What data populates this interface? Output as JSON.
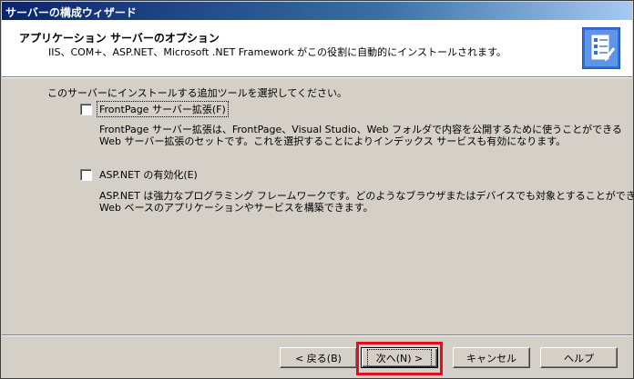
{
  "window": {
    "title": "サーバーの構成ウィザード"
  },
  "header": {
    "title": "アプリケーション サーバーのオプション",
    "subtitle": "IIS、COM+、ASP.NET、Microsoft .NET Framework がこの役割に自動的にインストールされます。",
    "icon": "wizard-checklist-icon"
  },
  "intro": "このサーバーにインストールする追加ツールを選択してください。",
  "options": [
    {
      "label": "FrontPage サーバー拡張(F)",
      "checked": false,
      "desc_line1": "FrontPage サーバー拡張は、FrontPage、Visual Studio、Web フォルダで内容を公開するために使うことができる",
      "desc_line2": "Web サーバー拡張のセットです。これを選択することによりインデックス サービスも有効になります。"
    },
    {
      "label": "ASP.NET の有効化(E)",
      "checked": false,
      "desc_line1": "ASP.NET は強力なプログラミング フレームワークです。どのようなブラウザまたはデバイスでも対象とすることができる",
      "desc_line2": "Web ベースのアプリケーションやサービスを構築できます。"
    }
  ],
  "buttons": {
    "back": "< 戻る(B)",
    "next": "次へ(N) >",
    "cancel": "キャンセル",
    "help": "ヘルプ"
  },
  "colors": {
    "titlebar": "#0a246a",
    "highlight": "#e0101a",
    "face": "#d4d0c8"
  }
}
